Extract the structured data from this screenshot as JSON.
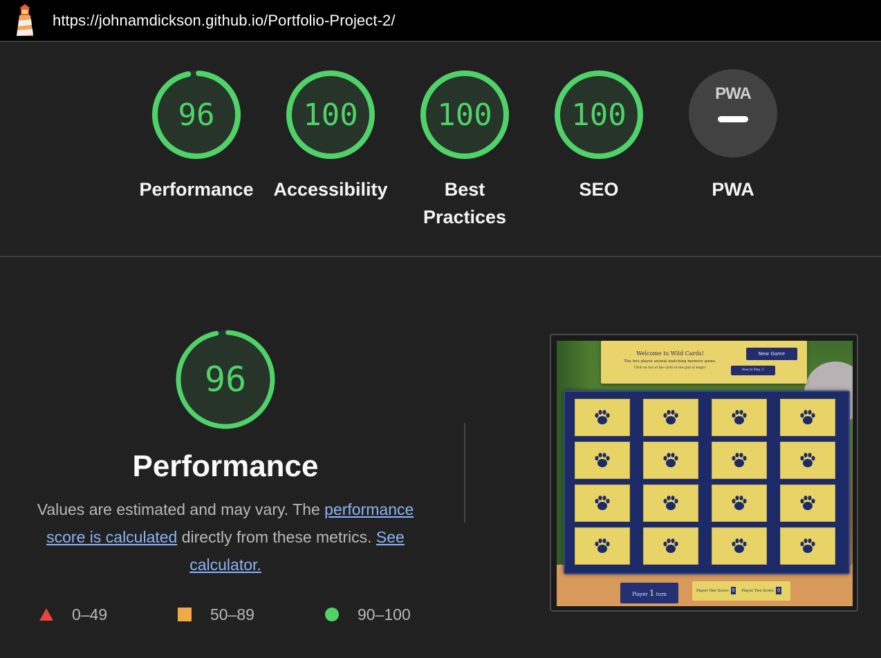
{
  "header": {
    "url": "https://johnamdickson.github.io/Portfolio-Project-2/",
    "logo_icon": "lighthouse-icon"
  },
  "categories": [
    {
      "id": "performance",
      "label": "Performance",
      "score": "96",
      "score_value": 96
    },
    {
      "id": "accessibility",
      "label": "Accessibility",
      "score": "100",
      "score_value": 100
    },
    {
      "id": "best-practices",
      "label": "Best Practices",
      "label_line1": "Best",
      "label_line2": "Practices",
      "score": "100",
      "score_value": 100
    },
    {
      "id": "seo",
      "label": "SEO",
      "score": "100",
      "score_value": 100
    },
    {
      "id": "pwa",
      "label": "PWA",
      "badge_text": "PWA",
      "score": "—"
    }
  ],
  "performance": {
    "score": "96",
    "score_value": 96,
    "title": "Performance",
    "description_prefix": "Values are estimated and may vary. The ",
    "link1_text": "performance score is calculated",
    "description_middle": " directly from these metrics. ",
    "link2_text": "See calculator."
  },
  "legend": [
    {
      "range": "0–49",
      "shape": "triangle",
      "color": "#e8453c"
    },
    {
      "range": "50–89",
      "shape": "square",
      "color": "#f2a846"
    },
    {
      "range": "90–100",
      "shape": "circle",
      "color": "#4fd268"
    }
  ],
  "colors": {
    "pass": "#4fd268",
    "background": "#212121",
    "link": "#8ab4f8"
  },
  "screenshot": {
    "welcome_title": "Welcome to Wild Cards!",
    "welcome_subtitle": "The two player animal matching memory game.",
    "welcome_instructions": "Click on two of the cards in the grid to begin!",
    "new_game_label": "New Game",
    "how_to_play_label": "How to Play ⓘ",
    "turn_prefix": "Player",
    "turn_number": "1",
    "turn_suffix": "turn",
    "player_one_label": "Player One Score:",
    "player_one_score": "0",
    "player_two_label": "Player Two Score:",
    "player_two_score": "0",
    "card_icon": "paw-icon",
    "card_count": 16
  }
}
